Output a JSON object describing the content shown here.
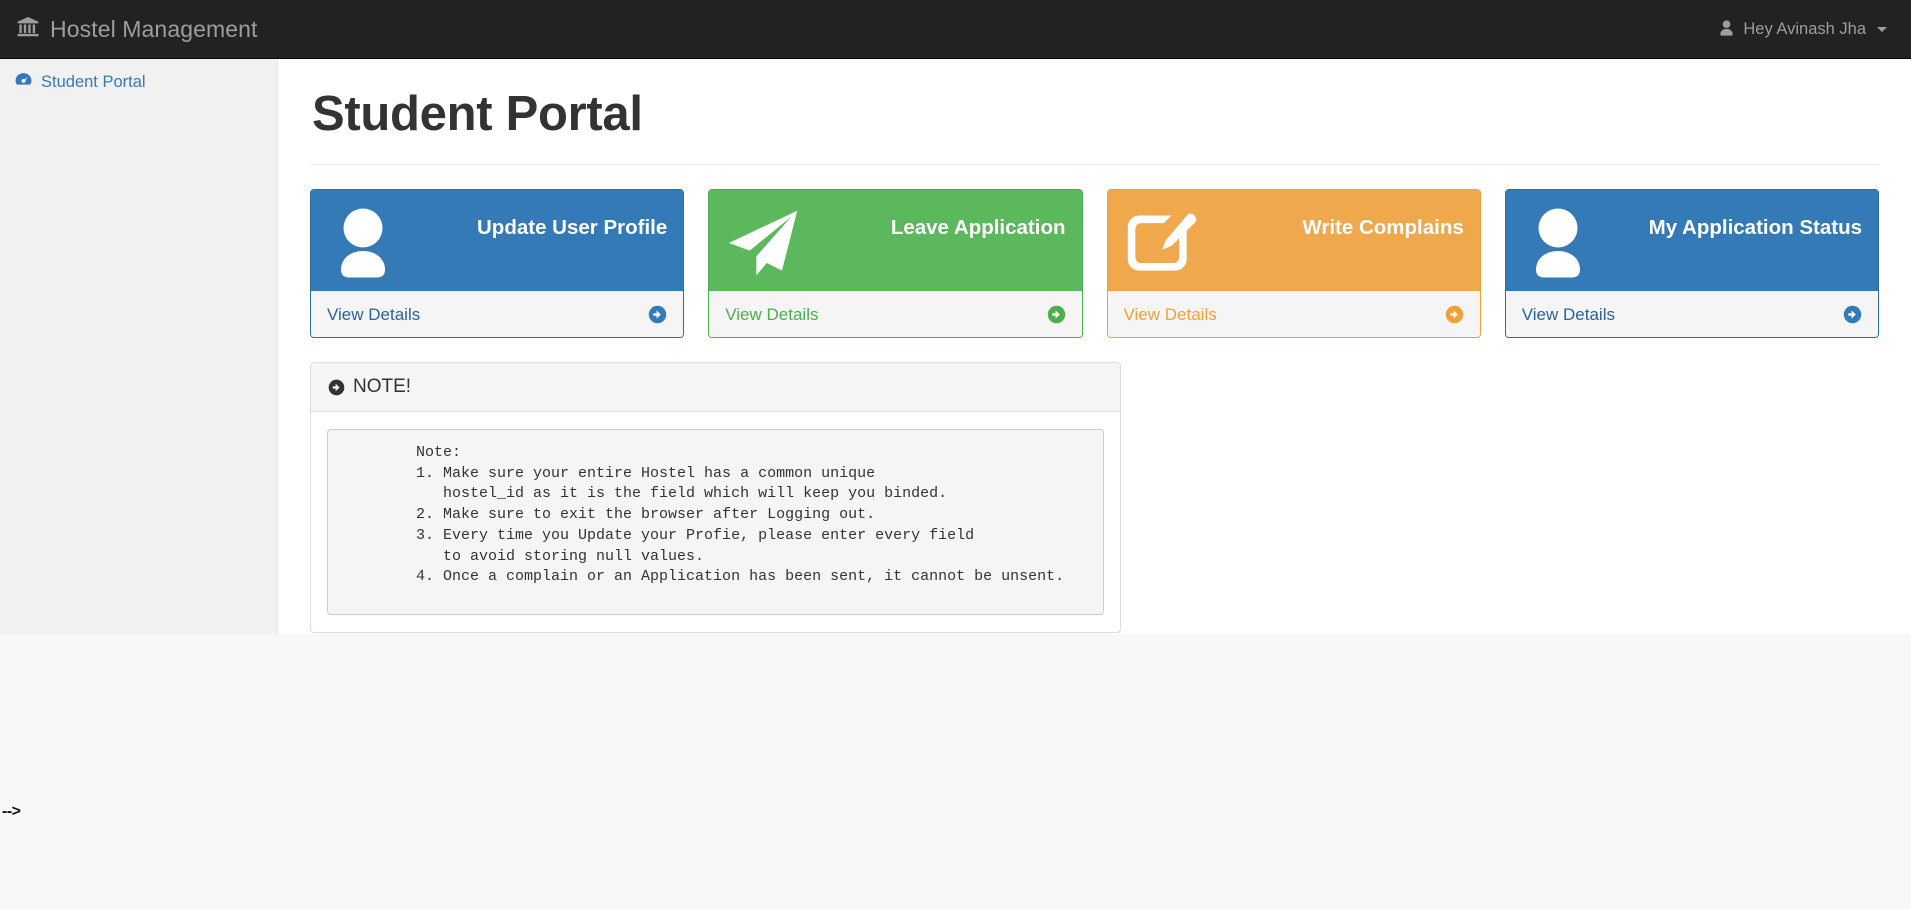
{
  "navbar": {
    "brand_icon": "bank-icon",
    "brand": "Hostel Management",
    "user_icon": "user-icon",
    "user_greeting": "Hey Avinash Jha",
    "caret_icon": "caret-down-icon"
  },
  "sidebar": {
    "items": [
      {
        "icon": "dashboard-icon",
        "label": "Student Portal"
      }
    ]
  },
  "main": {
    "page_title": "Student Portal",
    "cards": [
      {
        "title": "Update User Profile",
        "footer_label": "View Details",
        "icon": "user-icon",
        "arrow_icon": "arrow-circle-right-icon",
        "color": "#337ab7",
        "variant": "panel-blue"
      },
      {
        "title": "Leave Application",
        "footer_label": "View Details",
        "icon": "paper-plane-icon",
        "arrow_icon": "arrow-circle-right-icon",
        "color": "#5cb85c",
        "variant": "panel-green"
      },
      {
        "title": "Write Complains",
        "footer_label": "View Details",
        "icon": "pencil-square-icon",
        "arrow_icon": "arrow-circle-right-icon",
        "color": "#efa94c",
        "variant": "panel-orange"
      },
      {
        "title": "My Application Status",
        "footer_label": "View Details",
        "icon": "user-icon",
        "arrow_icon": "arrow-circle-right-icon",
        "color": "#337ab7",
        "variant": "panel-blue"
      }
    ],
    "note": {
      "head_icon": "arrow-circle-right-icon",
      "head_label": "NOTE!",
      "body": "        Note:\n        1. Make sure your entire Hostel has a common unique\n           hostel_id as it is the field which will keep you binded.\n        2. Make sure to exit the browser after Logging out.\n        3. Every time you Update your Profie, please enter every field\n           to avoid storing null values.\n        4. Once a complain or an Application has been sent, it cannot be unsent."
    }
  },
  "artifacts": {
    "stray_comment": "-->"
  },
  "colors": {
    "navbar_bg": "#222222",
    "sidebar_bg": "#f1f1f1",
    "link": "#337ab7",
    "blue": "#337ab7",
    "green": "#5cb85c",
    "orange": "#efa94c"
  }
}
